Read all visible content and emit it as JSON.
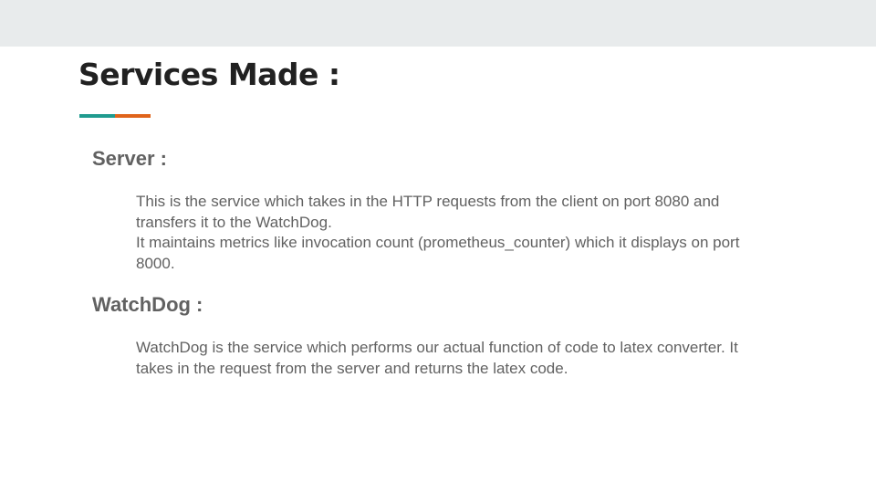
{
  "slide": {
    "title": "Services Made :",
    "sections": [
      {
        "heading": "Server :",
        "paragraphs": [
          "This is the service which takes in the HTTP requests from the client on port 8080 and transfers it to the WatchDog.",
          "It maintains metrics like invocation count (prometheus_counter) which it displays on port 8000."
        ]
      },
      {
        "heading": "WatchDog :",
        "paragraphs": [
          "WatchDog is the service which performs our actual function of code to latex converter. It takes in the request from the server and returns the latex code."
        ]
      }
    ]
  },
  "colors": {
    "accent_teal": "#1f9b8f",
    "accent_orange": "#e0641b",
    "title_text": "#212121",
    "body_text": "#616161",
    "top_band": "#e8ebec"
  }
}
